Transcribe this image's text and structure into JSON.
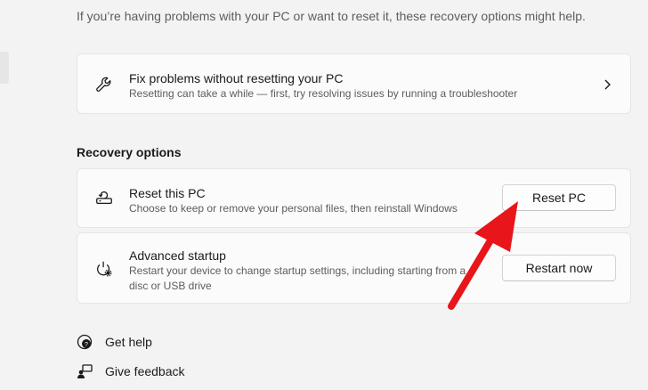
{
  "intro_text": "If you’re having problems with your PC or want to reset it, these recovery options might help.",
  "fix_card": {
    "title": "Fix problems without resetting your PC",
    "description": "Resetting can take a while — first, try resolving issues by running a troubleshooter",
    "icon": "wrench-icon"
  },
  "recovery": {
    "section_title": "Recovery options",
    "reset": {
      "title": "Reset this PC",
      "description": "Choose to keep or remove your personal files, then reinstall Windows",
      "button_label": "Reset PC",
      "icon": "reset-pc-icon"
    },
    "advanced": {
      "title": "Advanced startup",
      "description_line1": "Restart your device to change startup settings, including starting from a",
      "description_line2": "disc or USB drive",
      "button_label": "Restart now",
      "icon": "advanced-startup-icon"
    }
  },
  "links": {
    "help_label": "Get help",
    "feedback_label": "Give feedback"
  },
  "colors": {
    "annotation_arrow": "#e8151b",
    "background": "#f3f3f3",
    "card": "#fbfbfb"
  }
}
